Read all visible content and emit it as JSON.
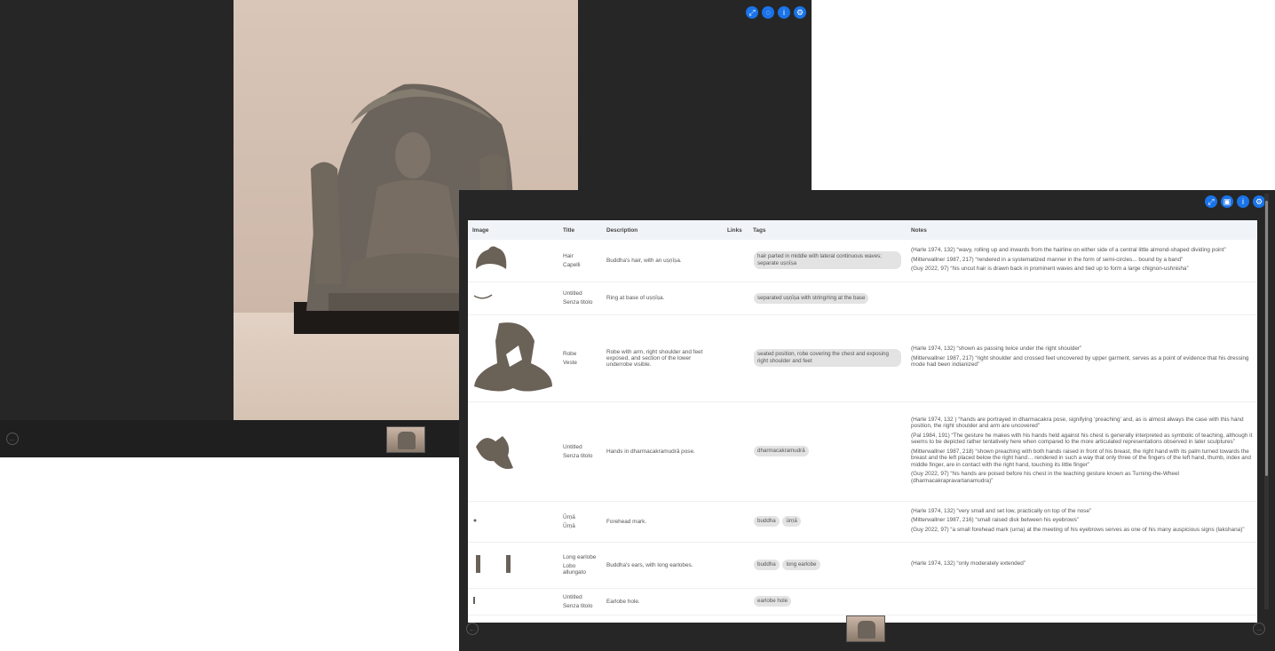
{
  "viewer": {
    "toolbar_icons": [
      "fullscreen-icon",
      "comment-icon",
      "info-icon",
      "settings-icon"
    ],
    "prev_icon": "←"
  },
  "table_viewer": {
    "toolbar_icons": [
      "fullscreen-icon",
      "gallery-icon",
      "info-icon",
      "settings-icon"
    ],
    "prev_icon": "←",
    "next_icon": "→",
    "columns": [
      "Image",
      "Title",
      "Description",
      "Links",
      "Tags",
      "Notes"
    ],
    "rows": [
      {
        "title": "Hair",
        "subtitle": "Capelli",
        "description": "Buddha's hair, with an uṣṇīṣa.",
        "links": "",
        "tags": [
          "hair parted in middle with lateral continuous waves; separate uṣṇīṣa"
        ],
        "notes": [
          "(Harle 1974, 132) “wavy, rolling up and inwards from the hairline on either side of a central little almond-shaped dividing point”",
          "(Mitterwallner 1987, 217) “rendered in a systematized manner in the form of semi-circles... bound by a band”",
          "(Guy 2022, 97) “his uncut hair is drawn back in prominent waves and tied up to form a large chignon-ushnisha”"
        ]
      },
      {
        "title": "Untitled",
        "subtitle": "Senza titolo",
        "description": "Ring at base of uṣṇīṣa.",
        "links": "",
        "tags": [
          "separated uṣṇīṣa with string/ring at the base"
        ],
        "notes": []
      },
      {
        "title": "Robe",
        "subtitle": "Veste",
        "description": "Robe with arm, right shoulder and feet exposed, and section of the lower underrobe visible.",
        "links": "",
        "tags": [
          "seated position, robe covering the chest and exposing right shoulder and feet"
        ],
        "notes": [
          "(Harle 1974, 132) “shown as passing twice under the right shoulder”",
          "(Mitterwallner 1987, 217) “right shoulder and crossed feet uncovered by upper garment, serves as a point of evidence that his dressing mode had been indianized”"
        ]
      },
      {
        "title": "Untitled",
        "subtitle": "Senza titolo",
        "description": "Hands in dharmacakramudrā pose.",
        "links": "",
        "tags": [
          "dharmacakramudrā"
        ],
        "notes": [
          "(Harle 1974, 132 ) “hands are portrayed in dharmacakra pose, signifying ‘preaching’ and, as is almost always the case with this hand position, the right shoulder and arm are uncovered”",
          "(Pal 1984, 191) “The gesture he makes with his hands held against his chest is generally interpreted as symbolic of teaching, although it seems to be depicted rather tentatively here when compared to the more articulated representations observed in later sculptures”",
          "(Mitterwallner 1987, 218) “shown preaching with both hands raised in front of his breast, the right hand with its palm turned towards the breast and the left placed below the right hand… rendered in such a way that only three of the fingers of the left hand, thumb, index and middle finger, are in contact with the right hand, touching its little finger”",
          "(Guy 2022, 97) “his hands are poised before his chest in the teaching gesture known as Turning-the-Wheel (dharmacakrapravartanamudra)”"
        ]
      },
      {
        "title": "Ūrṇā",
        "subtitle": "Ūrṇā",
        "description": "Forehead mark.",
        "links": "",
        "tags": [
          "buddha",
          "ūrṇā"
        ],
        "notes": [
          "(Harle 1974, 132) “very small and set low, practically on top of the nose”",
          "(Mitterwallner 1987, 216) “small raised disk between his eyebrows”",
          "(Guy 2022, 97) “a small forehead mark (urna) at the meeting of his eyebrows serves as one of his many auspicious signs (lakshana)”"
        ]
      },
      {
        "title": "Long earlobe",
        "subtitle": "Lobo allungato",
        "description": "Buddha's ears, with long earlobes.",
        "links": "",
        "tags": [
          "buddha",
          "long earlobe"
        ],
        "notes": [
          "(Harle 1974, 132) “only moderately extended”"
        ]
      },
      {
        "title": "Untitled",
        "subtitle": "Senza titolo",
        "description": "Earlobe hole.",
        "links": "",
        "tags": [
          "earlobe hole"
        ],
        "notes": []
      }
    ]
  }
}
